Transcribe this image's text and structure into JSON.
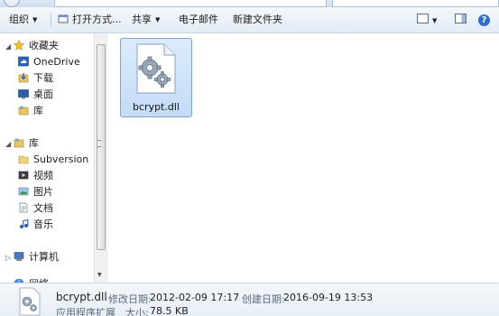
{
  "toolbar": {
    "organize": "组织",
    "open_with": "打开方式...",
    "share": "共享",
    "email": "电子邮件",
    "new_folder": "新建文件夹"
  },
  "nav": {
    "favorites": "收藏夹",
    "onedrive": "OneDrive",
    "downloads": "下载",
    "desktop": "桌面",
    "libraries_fav": "库",
    "libraries": "库",
    "subversion": "Subversion",
    "videos": "视频",
    "pictures": "图片",
    "documents": "文档",
    "music": "音乐",
    "computer": "计算机",
    "network": "网络"
  },
  "file": {
    "name": "bcrypt.dll"
  },
  "details": {
    "name": "bcrypt.dll",
    "type": "应用程序扩展",
    "modified_label": "修改日期:",
    "modified_value": "2012-02-09 17:17",
    "created_label": "创建日期:",
    "created_value": "2016-09-19 13:53",
    "size_label": "大小:",
    "size_value": "78.5 KB"
  },
  "icons": {
    "favorites": "star-icon",
    "onedrive": "cloud-icon",
    "downloads": "download-folder-icon",
    "desktop": "desktop-icon",
    "library": "library-icon",
    "videos": "video-icon",
    "pictures": "picture-icon",
    "documents": "document-icon",
    "music": "music-icon",
    "computer": "computer-icon",
    "network": "network-icon",
    "file": "dll-gear-icon"
  },
  "colors": {
    "selection_fill": "#c4dcf7",
    "selection_border": "#7da2ce",
    "toolbar_bg": "#e3ebf5"
  }
}
